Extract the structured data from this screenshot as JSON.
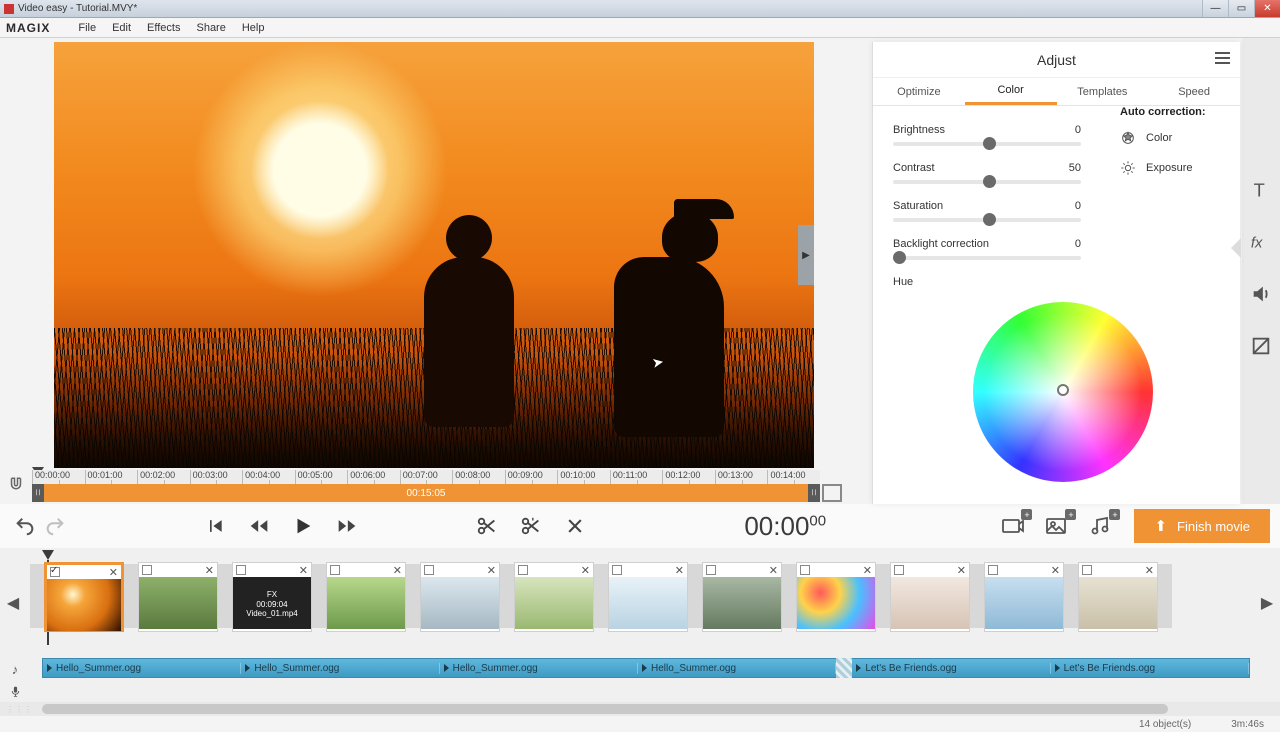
{
  "window": {
    "title": "Video easy - Tutorial.MVY*"
  },
  "menu": {
    "logo": "MAGIX",
    "items": [
      "File",
      "Edit",
      "Effects",
      "Share",
      "Help"
    ]
  },
  "ruler": {
    "ticks": [
      "00:00:00",
      "00:01:00",
      "00:02:00",
      "00:03:00",
      "00:04:00",
      "00:05:00",
      "00:06:00",
      "00:07:00",
      "00:08:00",
      "00:09:00",
      "00:10:00",
      "00:11:00",
      "00:12:00",
      "00:13:00",
      "00:14:00"
    ],
    "total": "00:15:05"
  },
  "inspector": {
    "title": "Adjust",
    "tabs": [
      "Optimize",
      "Color",
      "Templates",
      "Speed"
    ],
    "active_tab": 1,
    "sliders": {
      "brightness": {
        "label": "Brightness",
        "value": "0",
        "pos": 50
      },
      "contrast": {
        "label": "Contrast",
        "value": "50",
        "pos": 50
      },
      "saturation": {
        "label": "Saturation",
        "value": "0",
        "pos": 50
      },
      "backlight": {
        "label": "Backlight correction",
        "value": "0",
        "pos": 2
      }
    },
    "auto": {
      "title": "Auto correction:",
      "color": "Color",
      "exposure": "Exposure"
    },
    "hue_label": "Hue"
  },
  "transport": {
    "timecode": "00:00",
    "frames": "00",
    "finish_label": "Finish movie"
  },
  "storyboard": {
    "clips": [
      {
        "checked": true,
        "thumb_class": "tb0"
      },
      {
        "checked": false,
        "thumb_class": "tb1"
      },
      {
        "checked": false,
        "dark": true,
        "fx": "FX",
        "tc": "00:09:04",
        "name": "Video_01.mp4"
      },
      {
        "checked": false,
        "thumb_class": "tb3"
      },
      {
        "checked": false,
        "thumb_class": "tb4"
      },
      {
        "checked": false,
        "thumb_class": "tb5"
      },
      {
        "checked": false,
        "thumb_class": "tb6"
      },
      {
        "checked": false,
        "thumb_class": "tb7"
      },
      {
        "checked": false,
        "thumb_class": "tb8"
      },
      {
        "checked": false,
        "thumb_class": "tb9"
      },
      {
        "checked": false,
        "thumb_class": "tb10"
      },
      {
        "checked": false,
        "thumb_class": "tb11"
      }
    ]
  },
  "audio": {
    "segs": [
      "Hello_Summer.ogg",
      "Hello_Summer.ogg",
      "Hello_Summer.ogg",
      "Hello_Summer.ogg",
      "Let's Be Friends.ogg",
      "Let's Be Friends.ogg"
    ]
  },
  "status": {
    "objects": "14 object(s)",
    "duration": "3m:46s"
  }
}
